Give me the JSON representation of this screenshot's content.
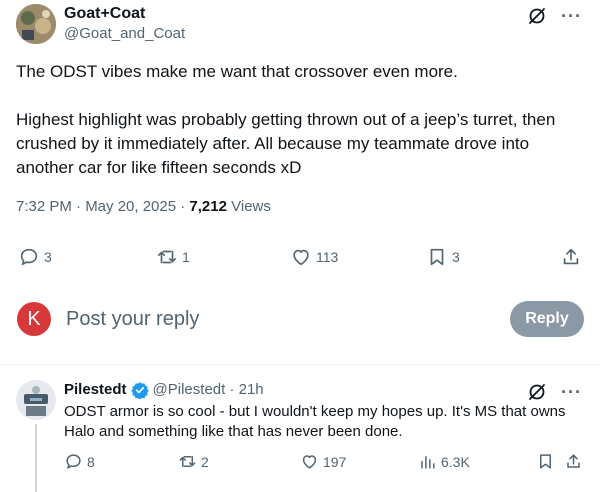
{
  "tweet": {
    "author_name": "Goat+Coat",
    "author_handle": "@Goat_and_Coat",
    "paragraphs": [
      "The ODST vibes make me want that crossover even more.",
      "Highest highlight was probably getting thrown out of a jeep’s turret, then crushed by it immediately after. All because my teammate drove into another car for like fifteen seconds xD"
    ],
    "time": "7:32 PM · May 20, 2025 · ",
    "views_count": "7,212",
    "views_label": " Views",
    "actions": {
      "replies": "3",
      "reposts": "1",
      "likes": "113",
      "bookmarks": "3"
    }
  },
  "composer": {
    "avatar_letter": "K",
    "placeholder": "Post your reply",
    "button_label": "Reply"
  },
  "reply": {
    "author_name": "Pilestedt",
    "author_handle": "@Pilestedt · 21h",
    "text": "ODST armor is so cool - but I wouldn't keep my hopes up. It's MS that owns Halo and something like that has never been done.",
    "actions": {
      "replies": "8",
      "reposts": "2",
      "likes": "197",
      "views": "6.3K"
    }
  },
  "icons": {
    "grok": "grok-icon",
    "more": "more-icon",
    "reply": "reply-icon",
    "repost": "repost-icon",
    "like": "heart-icon",
    "bookmark": "bookmark-icon",
    "share": "share-icon",
    "views": "views-icon",
    "verified": "verified-badge-icon"
  },
  "colors": {
    "text_primary": "#0f1419",
    "text_secondary": "#536471",
    "verified_blue": "#1d9bf0",
    "reply_button_bg": "#8b98a5",
    "composer_avatar_bg": "#d9383a"
  }
}
